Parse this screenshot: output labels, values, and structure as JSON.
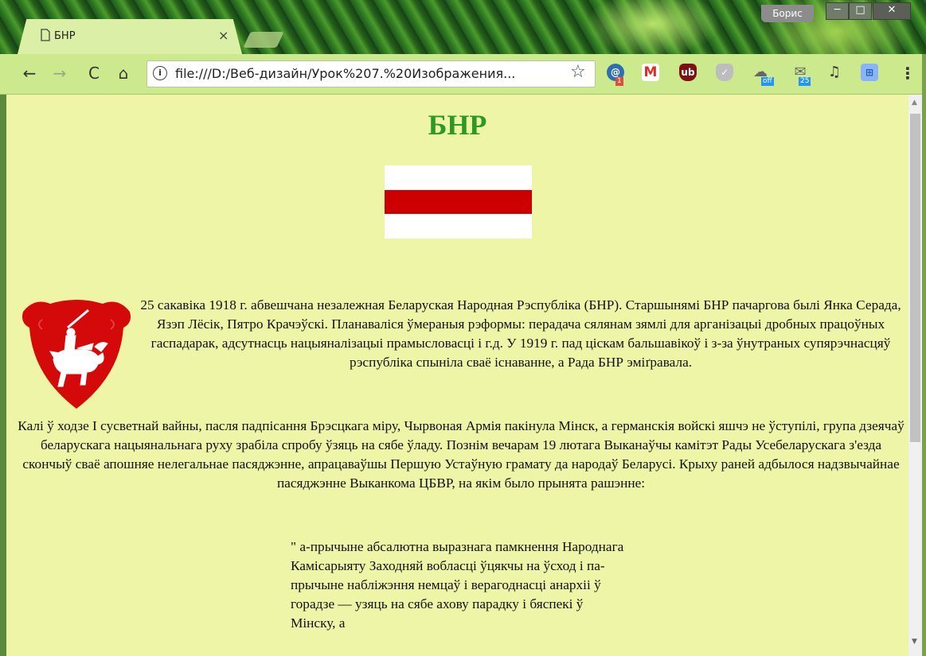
{
  "window": {
    "tab_title": "БНР",
    "tab_close": "×",
    "profile_name": "Борис",
    "min_label": "─",
    "max_label": "□",
    "close_label": "✕"
  },
  "toolbar": {
    "back": "←",
    "forward": "→",
    "reload": "C",
    "home": "⌂",
    "info": "i",
    "url": "file:///D:/Веб-дизайн/Урок%207.%20Изображения...",
    "star": "☆",
    "menu": "⋮"
  },
  "extensions": [
    {
      "name": "mail-ru-agent-icon",
      "glyph": "@",
      "badge": "1"
    },
    {
      "name": "gmail-icon",
      "glyph": "M",
      "badge": ""
    },
    {
      "name": "ublock-icon",
      "glyph": "ub",
      "badge": ""
    },
    {
      "name": "shield-check-icon",
      "glyph": "✓",
      "badge": ""
    },
    {
      "name": "cloud-sync-icon",
      "glyph": "☁",
      "badge": "off"
    },
    {
      "name": "mail-count-icon",
      "glyph": "✉",
      "badge": "25"
    },
    {
      "name": "music-icon",
      "glyph": "♫",
      "badge": ""
    },
    {
      "name": "screen-icon",
      "glyph": "⊞",
      "badge": ""
    }
  ],
  "page": {
    "title": "БНР",
    "para1": "25 сакавіка 1918 г. абвешчана незалежная Беларуская Народная Рэспубліка (БНР). Старшынямі БНР пачаргова былі Янка Серада, Язэп Лёсік, Пятро Крачэўскі. Планаваліся ўмераныя рэформы: перадача сялянам зямлі для арганізацыі дробных працоўных гаспадарак, адсутнасць нацыяналізацыі прамысловасці і г.д. У 1919 г. пад ціскам бальшавікоў і з-за ўнутраных супярэчнасцяў рэспубліка спыніла сваё існаванне, а Рада БНР эміґравала.",
    "para2": "Калі ў ходзе I сусветнай вайны, пасля падпісання Брэсцкага міру, Чырвоная Армія пакінула Мінск, а германскія войскі яшчэ не ўступілі, група дзеячаў беларускага нацыянальнага руху зрабіла спробу ўзяць на сябе ўладу. Познім вечарам 19 лютага Выканаўчы камітэт Рады Усебеларускага з'езда скончыў сваё апошняе нелегальнае пасяджэнне, апрацаваўшы Першую Устаўную грамату да народаў Беларусі. Крыху раней адбылося надзвычайнае пасяджэнне Выканкома ЦБВР, на якім было прынята рашэнне:",
    "quote": "\" а-прычыне абсалютна выразнага памкнення Народнага Камісарыяту Заходняй вобласці ўцякчы на ўсход і па-прычыне набліжэння немцаў і верагоднасці анархіі ў горадзе — узяць на сябе ахову парадку і бяспекі ў Мінску, а"
  },
  "colors": {
    "page_bg": "#eef5a6",
    "title_green": "#2c9a22",
    "flag_red": "#cc0000",
    "flag_white": "#ffffff"
  }
}
